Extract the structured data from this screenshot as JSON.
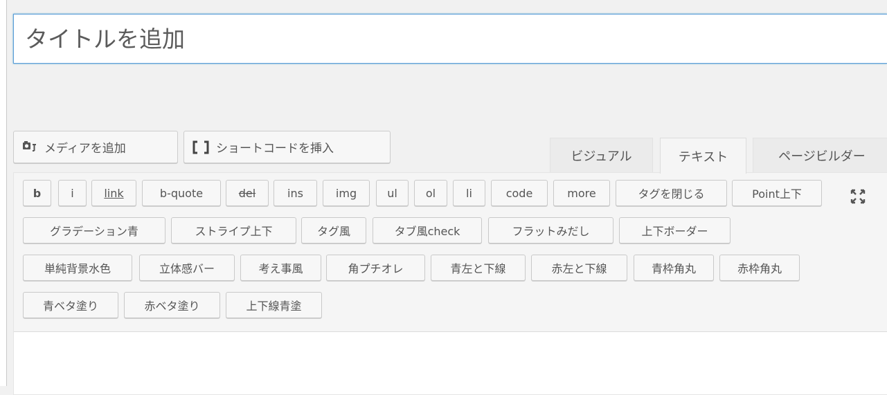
{
  "title_field": {
    "placeholder": "タイトルを追加",
    "value": ""
  },
  "media_buttons": {
    "add_media": {
      "label": "メディアを追加",
      "icon": "add-media-icon"
    },
    "insert_shortcode": {
      "label": "ショートコードを挿入",
      "icon": "shortcode-brackets-icon"
    }
  },
  "editor_tabs": [
    {
      "label": "ビジュアル",
      "active": false
    },
    {
      "label": "テキスト",
      "active": true
    },
    {
      "label": "ページビルダー",
      "active": false
    }
  ],
  "quicktags": {
    "row1": [
      "b",
      "i",
      "link",
      "b-quote",
      "del",
      "ins",
      "img",
      "ul",
      "ol",
      "li",
      "code",
      "more",
      "タグを閉じる",
      "Point上下"
    ],
    "row2": [
      "グラデーション青",
      "ストライプ上下",
      "タグ風",
      "タブ風check",
      "フラットみだし",
      "上下ボーダー"
    ],
    "row3": [
      "単純背景水色",
      "立体感バー",
      "考え事風",
      "角プチオレ",
      "青左と下線",
      "赤左と下線",
      "青枠角丸",
      "赤枠角丸"
    ],
    "row4": [
      "青ベタ塗り",
      "赤ベタ塗り",
      "上下線青塗"
    ],
    "fullscreen_icon": "fullscreen-toggle-icon"
  },
  "colors": {
    "focus_border": "#5b9dd9",
    "button_bg": "#f7f7f7",
    "button_border": "#c9c9c9",
    "text": "#555555"
  }
}
